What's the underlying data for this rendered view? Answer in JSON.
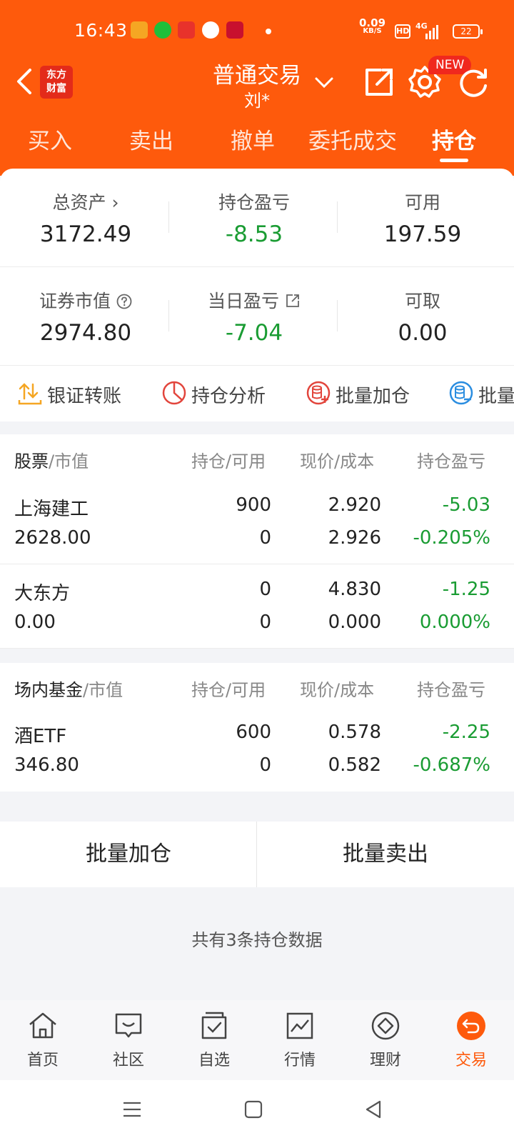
{
  "status_bar": {
    "time": "16:43",
    "net_speed_value": "0.09",
    "net_speed_unit": "KB/S",
    "hd_label": "HD",
    "signal_label": "4G",
    "battery": "22"
  },
  "nav": {
    "logo_line1": "东方",
    "logo_line2": "财富",
    "title": "普通交易",
    "subtitle": "刘*",
    "new_badge": "NEW"
  },
  "tabs": [
    "买入",
    "卖出",
    "撤单",
    "委托成交",
    "持仓"
  ],
  "active_tab": "持仓",
  "summary": {
    "total_assets_label": "总资产",
    "total_assets": "3172.49",
    "position_pnl_label": "持仓盈亏",
    "position_pnl": "-8.53",
    "available_label": "可用",
    "available": "197.59",
    "market_value_label": "证券市值",
    "market_value": "2974.80",
    "daily_pnl_label": "当日盈亏",
    "daily_pnl": "-7.04",
    "withdrawable_label": "可取",
    "withdrawable": "0.00"
  },
  "actions": [
    "银证转账",
    "持仓分析",
    "批量加仓",
    "批量"
  ],
  "stocks_section": {
    "header_name": "股票",
    "header_name_suffix": "/市值",
    "header_qty": "持仓/可用",
    "header_price": "现价/成本",
    "header_pnl": "持仓盈亏",
    "rows": [
      {
        "name": "上海建工",
        "market_value": "2628.00",
        "qty": "900",
        "available": "0",
        "price": "2.920",
        "cost": "2.926",
        "pnl": "-5.03",
        "pnl_pct": "-0.205%"
      },
      {
        "name": "大东方",
        "market_value": "0.00",
        "qty": "0",
        "available": "0",
        "price": "4.830",
        "cost": "0.000",
        "pnl": "-1.25",
        "pnl_pct": "0.000%"
      }
    ]
  },
  "funds_section": {
    "header_name": "场内基金",
    "header_name_suffix": "/市值",
    "header_qty": "持仓/可用",
    "header_price": "现价/成本",
    "header_pnl": "持仓盈亏",
    "rows": [
      {
        "name": "酒ETF",
        "market_value": "346.80",
        "qty": "600",
        "available": "0",
        "price": "0.578",
        "cost": "0.582",
        "pnl": "-2.25",
        "pnl_pct": "-0.687%"
      }
    ]
  },
  "buttons": {
    "batch_add": "批量加仓",
    "batch_sell": "批量卖出"
  },
  "footer_note": "共有3条持仓数据",
  "bottom_nav": [
    "首页",
    "社区",
    "自选",
    "行情",
    "理财",
    "交易"
  ],
  "colors": {
    "brand": "#fe5a0c",
    "loss_green": "#1a9c33",
    "badge_red": "#f0281e"
  }
}
